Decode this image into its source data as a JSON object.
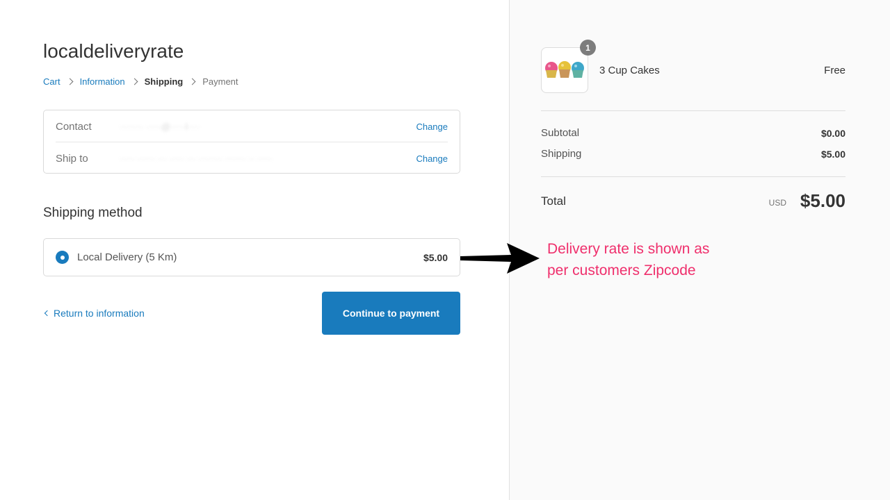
{
  "store": {
    "title": "localdeliveryrate"
  },
  "breadcrumb": {
    "cart": "Cart",
    "information": "Information",
    "shipping": "Shipping",
    "payment": "Payment"
  },
  "review": {
    "contact_label": "Contact",
    "contact_value": "········ ·····@·····l····",
    "ship_to_label": "Ship to",
    "ship_to_value": "····· ······ ··· ····· ··· ········ ······· ·· ·····",
    "change_label": "Change"
  },
  "shipping_method": {
    "title": "Shipping method",
    "option_name": "Local Delivery (5 Km)",
    "option_price": "$5.00",
    "selected": true
  },
  "nav": {
    "return_label": "Return to information",
    "continue_label": "Continue to payment"
  },
  "order_summary": {
    "product_name": "3 Cup Cakes",
    "product_price": "Free",
    "quantity": "1",
    "subtotal_label": "Subtotal",
    "subtotal_value": "$0.00",
    "shipping_label": "Shipping",
    "shipping_value": "$5.00",
    "total_label": "Total",
    "total_currency": "USD",
    "total_value": "$5.00"
  },
  "annotation": {
    "line1": "Delivery rate is shown as",
    "line2": "per customers Zipcode"
  },
  "colors": {
    "accent": "#197bbd",
    "annotation": "#ef2f6c",
    "sidebar_bg": "#fafafa"
  }
}
